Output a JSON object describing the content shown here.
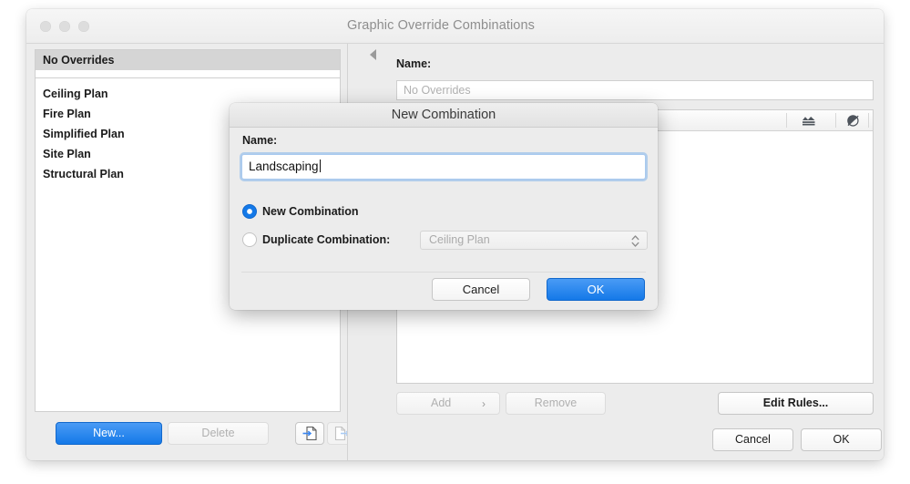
{
  "window": {
    "title": "Graphic Override Combinations",
    "traffic_lights": [
      "close",
      "minimize",
      "zoom"
    ]
  },
  "left_pane": {
    "selected_item": "No Overrides",
    "items": [
      "Ceiling Plan",
      "Fire Plan",
      "Simplified Plan",
      "Site Plan",
      "Structural Plan"
    ],
    "buttons": {
      "new_label": "New...",
      "delete_label": "Delete",
      "import_icon": "import-document-icon",
      "export_icon": "export-document-icon"
    }
  },
  "right_pane": {
    "name_label": "Name:",
    "name_value": "No Overrides",
    "table_header_icons": [
      "surface-pattern-icon",
      "hatch-override-icon",
      "fill-pen-icon"
    ],
    "buttons": {
      "add_label": "Add",
      "add_chevron": "›",
      "remove_label": "Remove",
      "edit_rules_label": "Edit Rules...",
      "cancel_label": "Cancel",
      "ok_label": "OK"
    }
  },
  "sheet": {
    "title": "New Combination",
    "name_label": "Name:",
    "name_value": "Landscaping",
    "radio_new_label": "New Combination",
    "radio_duplicate_label": "Duplicate Combination:",
    "radio_selected": "new",
    "duplicate_select_value": "Ceiling Plan",
    "select_arrows": "⌃⌄",
    "cancel_label": "Cancel",
    "ok_label": "OK"
  },
  "colors": {
    "accent_blue": "#1479e8",
    "focus_ring": "#6aa8eb",
    "window_bg": "#ececec",
    "selection_grey": "#d5d5d5"
  }
}
